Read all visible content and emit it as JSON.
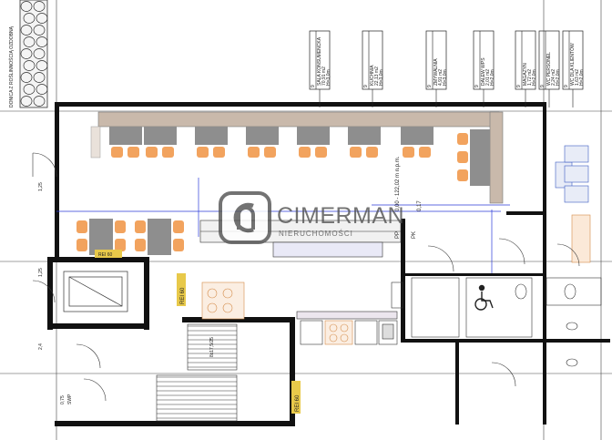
{
  "drawing": {
    "title_left": "DONICA Z ROŚLINNOŚCIĄ OZDOBNĄ",
    "dimension_v": "0,00 - 122,02 m n.p.m.",
    "level": "0,17",
    "pp": "PP",
    "pk": "PK",
    "stairs_note": "8x17,5/25",
    "left_dims": [
      "1,25",
      "1,25",
      "2,4"
    ],
    "bottom_small": "0,75",
    "bottom_small2": "SWP",
    "fire_labels": [
      "REI 60",
      "REI 60",
      "REI 60"
    ],
    "room_tags": [
      {
        "n": "9",
        "name": "SALA KONSUMENCKA",
        "area": "70,91 m2",
        "h": "H=3,0m"
      },
      {
        "n": "9",
        "name": "KUCHNIA",
        "area": "22,13 m2",
        "h": "H=3,0m"
      },
      {
        "n": "9",
        "name": "ZMYWALNIA",
        "area": "4,91 m2",
        "h": "H=3,0m"
      },
      {
        "n": "9",
        "name": "DALEW WPS",
        "area": "2,01 m2",
        "h": "H=2,0m"
      },
      {
        "n": "9",
        "name": "MAGAZYN",
        "area": "1,72 m2",
        "h": "H=2,0m"
      },
      {
        "n": "9",
        "name": "WC PERSONEL",
        "area": "2,24 m2",
        "h": "H=2,0m"
      },
      {
        "n": "9",
        "name": "WC DLA KLIENTÓW",
        "area": "1,63 m2",
        "h": "H=2,0m"
      }
    ]
  },
  "watermark": {
    "brand": "CIMERMAN",
    "sub": "NIERUCHOMOŚCI"
  },
  "colors": {
    "wall": "#111111",
    "counter": "#c9b9ab",
    "furniture": "#888888",
    "chair": "#f2a35e",
    "fire_label": "#e8c94a",
    "blue_line": "#2b3ad8",
    "watermark": "#8a8a8a"
  }
}
